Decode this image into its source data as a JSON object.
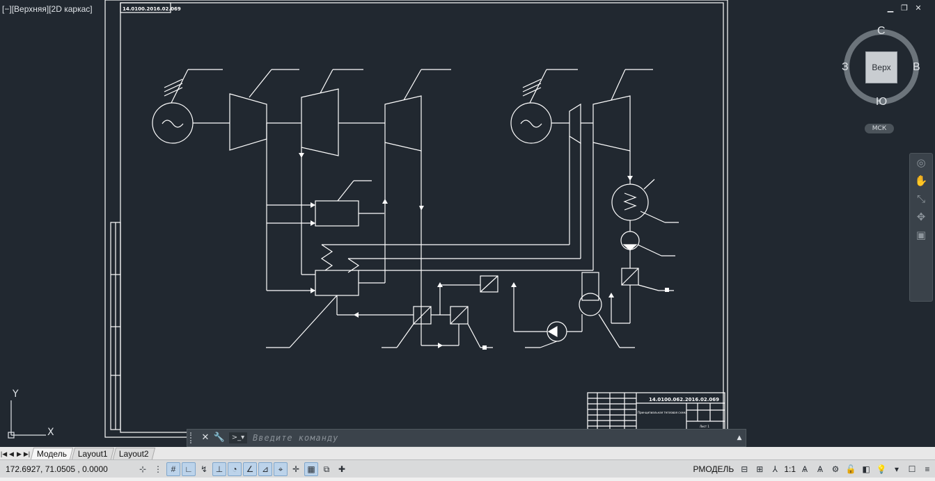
{
  "viewport": {
    "minimize_bracket": "[−]",
    "view_name": "[Верхняя]",
    "visual_style": "[2D каркас]"
  },
  "sheet": {
    "top_stamp": "14.0100.2016.02.069",
    "title_block_code": "14.0100.062.2016.02.069",
    "title_block_name": "Принципиальная тепловая схема",
    "title_block_sub": "Лист 1"
  },
  "viewcube": {
    "north": "С",
    "south": "Ю",
    "west": "З",
    "east": "В",
    "face": "Верх",
    "ucs": "МСК"
  },
  "ucs_icon": {
    "x_label": "X",
    "y_label": "Y"
  },
  "command_line": {
    "placeholder": "Введите команду"
  },
  "layout_tabs": [
    "Модель",
    "Layout1",
    "Layout2"
  ],
  "active_tab": "Модель",
  "status": {
    "coordinates": "172.6927,  71.0505 , 0.0000",
    "space": "РМОДЕЛЬ",
    "scale": "1:1"
  },
  "colors": {
    "background": "#212830",
    "lines": "#ffffff",
    "statusbar": "#d9dadb"
  }
}
